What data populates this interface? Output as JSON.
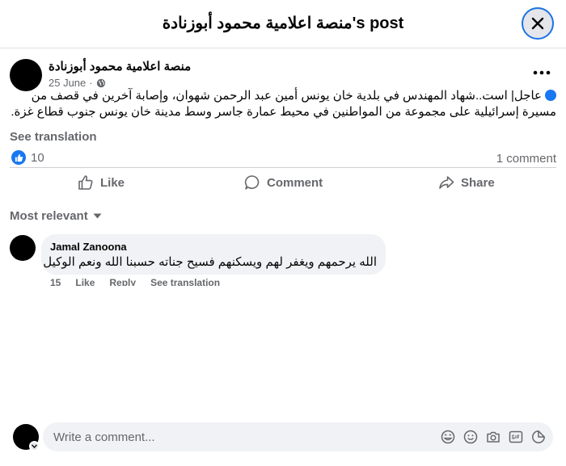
{
  "dialog": {
    "title": "منصة اعلامية محمود أبوزنادة's post"
  },
  "post": {
    "author": "منصة اعلامية محمود أبوزنادة",
    "date": "25 June",
    "audience_icon": "globe-icon",
    "line1": "عاجل| است..شهاد المهندس في بلدية خان يونس أمين عبد الرحمن شهوان، وإصابة آخرين في قصف من",
    "line2": "مسيرة إسرائيلية على مجموعة من المواطنين في محيط عمارة جاسر وسط مدينة خان يونس جنوب قطاع غزة.",
    "see_translation": "See translation",
    "reaction_count": "10",
    "comment_count": "1 comment"
  },
  "actions": {
    "like": "Like",
    "comment": "Comment",
    "share": "Share"
  },
  "comments": {
    "sort_label": "Most relevant",
    "items": [
      {
        "author": "Jamal Zanoona",
        "text": "الله يرحمهم ويغفر لهم ويسكنهم فسيح جناته حسبنا الله ونعم الوكيل",
        "time": "15",
        "like": "Like",
        "reply": "Reply",
        "see_translation": "See translation"
      }
    ]
  },
  "composer": {
    "placeholder": "Write a comment...",
    "tools": [
      "avatar-sticker-icon",
      "emoji-icon",
      "camera-icon",
      "gif-icon",
      "sticker-icon"
    ]
  },
  "colors": {
    "accent": "#1877f2",
    "secondary_text": "#65676b",
    "bubble": "#f0f2f5"
  }
}
